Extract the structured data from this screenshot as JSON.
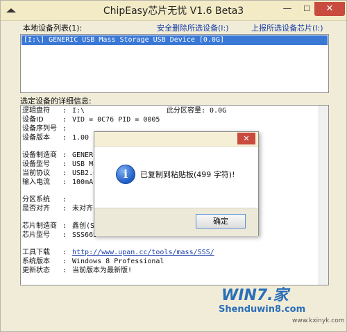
{
  "window": {
    "title": "ChipEasy芯片无忧 V1.6 Beta3",
    "min_glyph": "—",
    "max_glyph": "☐",
    "close_glyph": "✕"
  },
  "devices": {
    "label": "本地设备列表(1):",
    "safe_remove": "安全删除所选设备(I:)",
    "report_chip": "上报所选设备芯片(I:)",
    "items": [
      "[I:\\] GENERIC USB Mass Storage USB Device [0.0G]"
    ]
  },
  "details": {
    "label": "选定设备的详细信息:",
    "rows": [
      {
        "k": "逻辑盘符",
        "v": "I:\\",
        "extra": "此分区容量:  0.0G"
      },
      {
        "k": "设备ID",
        "v": "VID = 0C76     PID = 0005"
      },
      {
        "k": "设备序列号",
        "v": ""
      },
      {
        "k": "设备版本",
        "v": "1.00"
      },
      {
        "k": "设备制造商",
        "v": "GENERI"
      },
      {
        "k": "设备型号",
        "v": "USB Ma"
      },
      {
        "k": "当前协议",
        "v": "USB2.0"
      },
      {
        "k": "输入电流",
        "v": "100mA"
      },
      {
        "k": "分区系统",
        "v": ""
      },
      {
        "k": "是否对齐",
        "v": "未对齐"
      },
      {
        "k": "芯片制造商",
        "v": "鑫创(S"
      },
      {
        "k": "芯片型号",
        "v": "SSS669"
      },
      {
        "k": "工具下载",
        "v": "http://www.upan.cc/tools/mass/SSS/"
      },
      {
        "k": "系统版本",
        "v": "Windows 8 Professional"
      },
      {
        "k": "更新状态",
        "v": "当前版本为最新版!"
      }
    ]
  },
  "dialog": {
    "close_glyph": "✕",
    "icon_glyph": "i",
    "message": "已复制到粘贴板(499 字符)!",
    "ok": "确定"
  },
  "watermark": {
    "logo": "WIN7.家",
    "site": "Shenduwin8.com",
    "url": "www.kxinyk.com"
  }
}
